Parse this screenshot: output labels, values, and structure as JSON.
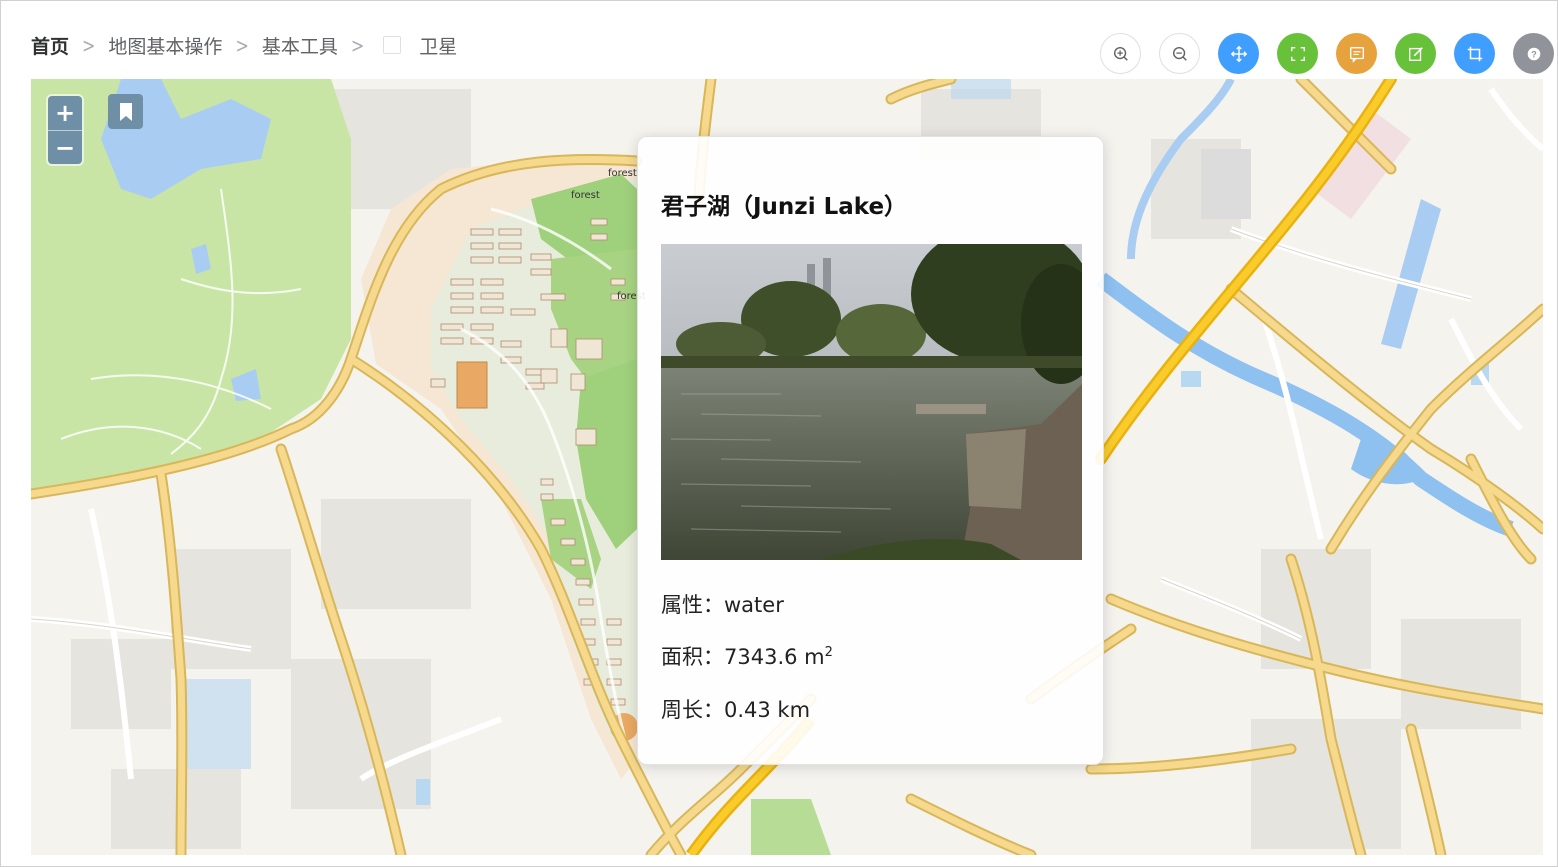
{
  "breadcrumb": {
    "home": "首页",
    "level1": "地图基本操作",
    "level2": "基本工具",
    "current": "卫星",
    "separator": ">"
  },
  "toolbar": [
    {
      "name": "zoom-in-tool-button",
      "icon": "zoom-in-icon",
      "color": "#ffffff"
    },
    {
      "name": "zoom-out-tool-button",
      "icon": "zoom-out-icon",
      "color": "#ffffff"
    },
    {
      "name": "pan-tool-button",
      "icon": "move-icon",
      "color": "#409eff"
    },
    {
      "name": "full-extent-button",
      "icon": "fullscreen-icon",
      "color": "#67c23a"
    },
    {
      "name": "message-button",
      "icon": "message-icon",
      "color": "#e6a23c"
    },
    {
      "name": "edit-button",
      "icon": "edit-icon",
      "color": "#67c23a"
    },
    {
      "name": "crop-button",
      "icon": "crop-icon",
      "color": "#409eff"
    },
    {
      "name": "help-button",
      "icon": "question-icon",
      "color": "#909399"
    }
  ],
  "map": {
    "zoom_in": "+",
    "zoom_out": "−",
    "labels": [
      "forest",
      "forest",
      "forest"
    ]
  },
  "popup": {
    "title": "君子湖（Junzi Lake）",
    "attr_label": "属性：",
    "attr_value": "water",
    "area_label": "面积：",
    "area_value": "7343.6 m",
    "area_unit_sup": "2",
    "perimeter_label": "周长：",
    "perimeter_value": "0.43 km"
  }
}
